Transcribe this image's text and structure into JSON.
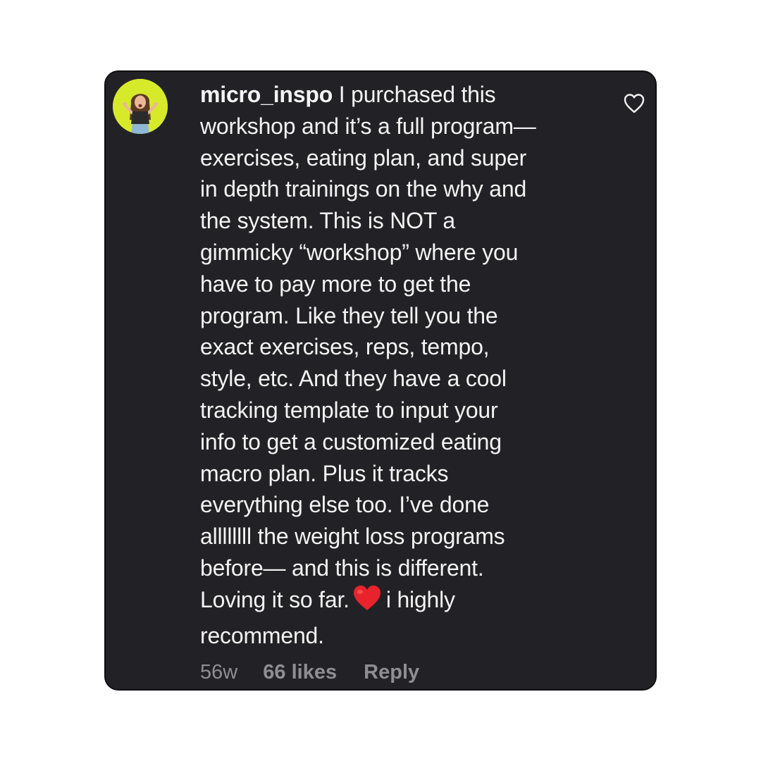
{
  "comment": {
    "username": "micro_inspo",
    "text_lines": [
      " I purchased this",
      "workshop and it’s a full program—",
      "exercises, eating plan, and super",
      "in depth trainings on the why and",
      "the system. This is NOT a",
      "gimmicky “workshop” where you",
      "have to pay more to get the",
      "program. Like they tell you the",
      "exact exercises, reps, tempo,",
      "style, etc. And they have a cool",
      "tracking template to input your",
      "info to get a customized eating",
      "macro plan. Plus it tracks",
      "everything else too. I’ve done",
      "allllllll the weight loss programs",
      "before— and this is different."
    ],
    "line_17_before_emoji": "Loving it so far.",
    "emoji": "red-heart-emoji",
    "line_17_after_emoji": "i highly",
    "last_line": "recommend.",
    "time_ago": "56w",
    "likes": "66 likes",
    "reply_label": "Reply"
  },
  "icons": {
    "like": "heart-outline-icon",
    "avatar": "user-avatar"
  },
  "colors": {
    "card_background": "#222226",
    "text": "#f3f3f3",
    "meta_text": "#8e8e93",
    "avatar_background": "#d7ea2a",
    "emoji_red": "#e8232b"
  }
}
